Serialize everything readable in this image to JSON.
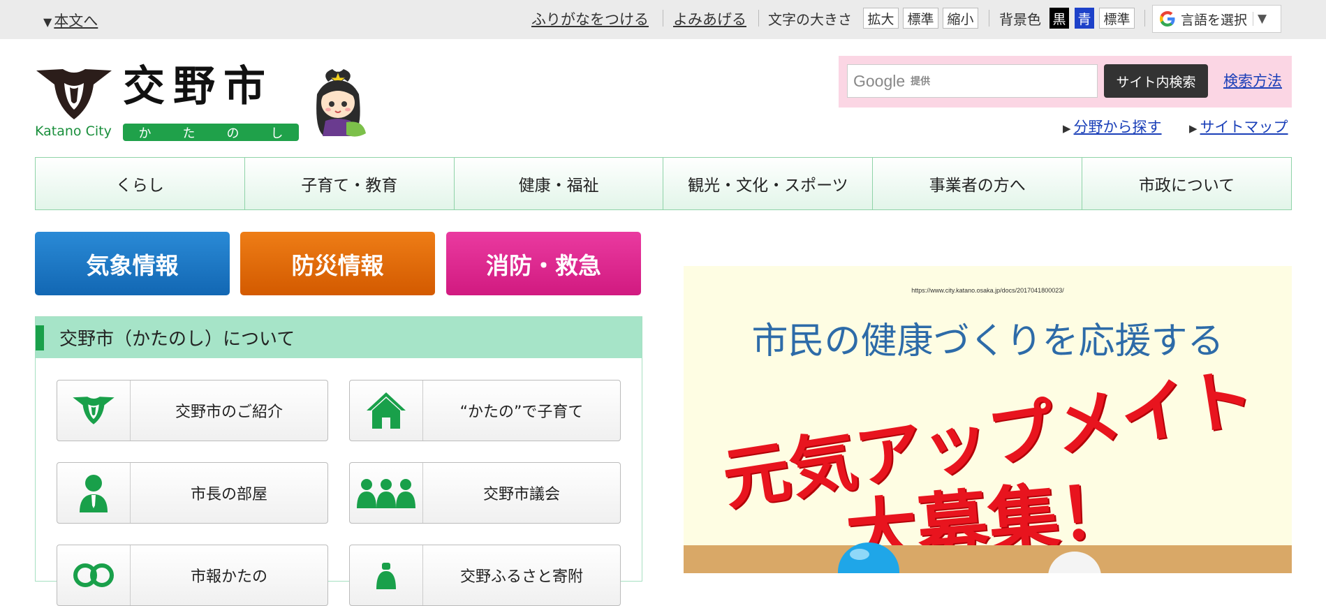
{
  "utility": {
    "skip_link": "本文へ",
    "furigana": "ふりがなをつける",
    "read_aloud": "よみあげる",
    "text_size_label": "文字の大きさ",
    "text_size_buttons": [
      "拡大",
      "標準",
      "縮小"
    ],
    "bg_label": "背景色",
    "bg_buttons": [
      "黒",
      "青",
      "標準"
    ],
    "language_select": "言語を選択",
    "language_arrow": "▼"
  },
  "header": {
    "title": "交野市",
    "title_en": "Katano City",
    "title_kana": [
      "か",
      "た",
      "の",
      "し"
    ],
    "search_provider": "Google",
    "search_provider_sub": "提供",
    "search_button": "サイト内検索",
    "search_help": "検索方法",
    "links": [
      "分野から探す",
      "サイトマップ"
    ]
  },
  "nav": [
    "くらし",
    "子育て・教育",
    "健康・福祉",
    "観光・文化・スポーツ",
    "事業者の方へ",
    "市政について"
  ],
  "emergency": {
    "weather": "気象情報",
    "disaster": "防災情報",
    "fire": "消防・救急"
  },
  "about": {
    "title": "交野市（かたのし）について",
    "tiles": [
      "交野市のご紹介",
      "“かたの”で子育て",
      "市長の部屋",
      "交野市議会",
      "市報かたの",
      "交野ふるさと寄附"
    ]
  },
  "banner": {
    "url": "https://www.city.katano.osaka.jp/docs/2017041800023/",
    "headline": "市民の健康づくりを応援する",
    "big_line1": "元気アップメイト",
    "big_line2": "大募集！"
  },
  "colors": {
    "accent_green": "#19a04a",
    "nav_border": "#8fd3a8",
    "weather_blue": "#1b77c4",
    "disaster_orange": "#e06a08",
    "fire_pink": "#df2a90",
    "search_bg": "#fbd6e4",
    "link_blue": "#1a3fb8"
  }
}
